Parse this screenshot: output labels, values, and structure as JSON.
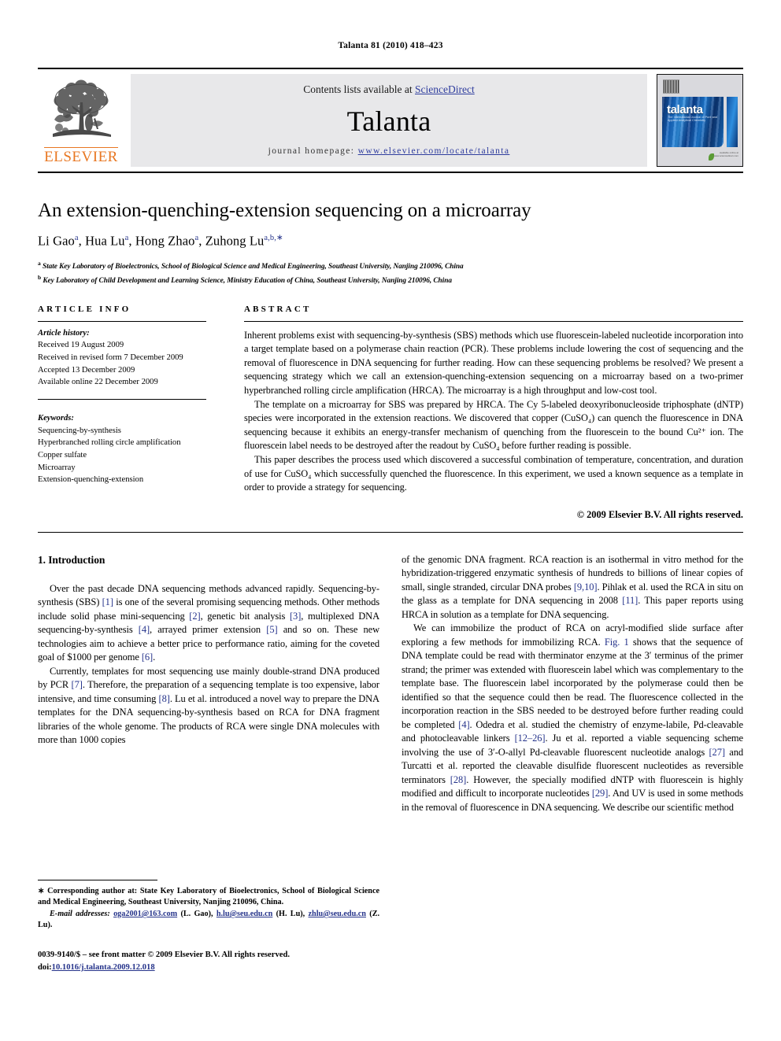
{
  "running_head": "Talanta 81 (2010) 418–423",
  "masthead": {
    "publisher_name": "ELSEVIER",
    "contents_prefix": "Contents lists available at ",
    "contents_link": "ScienceDirect",
    "journal_title": "Talanta",
    "homepage_label": "journal homepage:",
    "homepage_url": "www.elsevier.com/locate/talanta",
    "cover_title": "talanta",
    "cover_subtitle": "The International Journal of Pure and Applied Analytical Chemistry",
    "cover_footer": "available online at\nwww.sciencedirect.com",
    "link_color": "#2f3d9e",
    "brand_color": "#E87722"
  },
  "article": {
    "title": "An extension-quenching-extension sequencing on a microarray",
    "authors": [
      {
        "name": "Li Gao",
        "sup": "a"
      },
      {
        "name": "Hua Lu",
        "sup": "a"
      },
      {
        "name": "Hong Zhao",
        "sup": "a"
      },
      {
        "name": "Zuhong Lu",
        "sup": "a,b,∗"
      }
    ],
    "authors_line": "Li Gaoᵃ, Hua Luᵃ, Hong Zhaoᵃ, Zuhong Luᵃᵇ,*",
    "affiliations": [
      {
        "sup": "a",
        "text": "State Key Laboratory of Bioelectronics, School of Biological Science and Medical Engineering, Southeast University, Nanjing 210096, China"
      },
      {
        "sup": "b",
        "text": "Key Laboratory of Child Development and Learning Science, Ministry Education of China, Southeast University, Nanjing 210096, China"
      }
    ]
  },
  "article_info": {
    "heading": "ARTICLE INFO",
    "history_label": "Article history:",
    "history": [
      "Received 19 August 2009",
      "Received in revised form 7 December 2009",
      "Accepted 13 December 2009",
      "Available online 22 December 2009"
    ],
    "keywords_label": "Keywords:",
    "keywords": [
      "Sequencing-by-synthesis",
      "Hyperbranched rolling circle amplification",
      "Copper sulfate",
      "Microarray",
      "Extension-quenching-extension"
    ]
  },
  "abstract": {
    "heading": "ABSTRACT",
    "paragraphs": [
      "Inherent problems exist with sequencing-by-synthesis (SBS) methods which use fluorescein-labeled nucleotide incorporation into a target template based on a polymerase chain reaction (PCR). These problems include lowering the cost of sequencing and the removal of fluorescence in DNA sequencing for further reading. How can these sequencing problems be resolved? We present a sequencing strategy which we call an extension-quenching-extension sequencing on a microarray based on a two-primer hyperbranched rolling circle amplification (HRCA). The microarray is a high throughput and low-cost tool.",
      "The template on a microarray for SBS was prepared by HRCA. The Cy 5-labeled deoxyribonucleoside triphosphate (dNTP) species were incorporated in the extension reactions. We discovered that copper (CuSO₄) can quench the fluorescence in DNA sequencing because it exhibits an energy-transfer mechanism of quenching from the fluorescein to the bound Cu²⁺ ion. The fluorescein label needs to be destroyed after the readout by CuSO₄ before further reading is possible.",
      "This paper describes the process used which discovered a successful combination of temperature, concentration, and duration of use for CuSO₄ which successfully quenched the fluorescence. In this experiment, we used a known sequence as a template in order to provide a strategy for sequencing."
    ],
    "copyright": "© 2009 Elsevier B.V. All rights reserved."
  },
  "body": {
    "section_number_title": "1. Introduction",
    "left_paragraphs": [
      "Over the past decade DNA sequencing methods advanced rapidly. Sequencing-by-synthesis (SBS) [1] is one of the several promising sequencing methods. Other methods include solid phase mini-sequencing [2], genetic bit analysis [3], multiplexed DNA sequencing-by-synthesis [4], arrayed primer extension [5] and so on. These new technologies aim to achieve a better price to performance ratio, aiming for the coveted goal of $1000 per genome [6].",
      "Currently, templates for most sequencing use mainly double-strand DNA produced by PCR [7]. Therefore, the preparation of a sequencing template is too expensive, labor intensive, and time consuming [8]. Lu et al. introduced a novel way to prepare the DNA templates for the DNA sequencing-by-synthesis based on RCA for DNA fragment libraries of the whole genome. The products of RCA were single DNA molecules with more than 1000 copies"
    ],
    "right_paragraphs": [
      "of the genomic DNA fragment. RCA reaction is an isothermal in vitro method for the hybridization-triggered enzymatic synthesis of hundreds to billions of linear copies of small, single stranded, circular DNA probes [9,10]. Pihlak et al. used the RCA in situ on the glass as a template for DNA sequencing in 2008 [11]. This paper reports using HRCA in solution as a template for DNA sequencing.",
      "We can immobilize the product of RCA on acryl-modified slide surface after exploring a few methods for immobilizing RCA. Fig. 1 shows that the sequence of DNA template could be read with therminator enzyme at the 3′ terminus of the primer strand; the primer was extended with fluorescein label which was complementary to the template base. The fluorescein label incorporated by the polymerase could then be identified so that the sequence could then be read. The fluorescence collected in the incorporation reaction in the SBS needed to be destroyed before further reading could be completed [4]. Odedra et al. studied the chemistry of enzyme-labile, Pd-cleavable and photocleavable linkers [12–26]. Ju et al. reported a viable sequencing scheme involving the use of 3′-O-allyl Pd-cleavable fluorescent nucleotide analogs [27] and Turcatti et al. reported the cleavable disulfide fluorescent nucleotides as reversible terminators [28]. However, the specially modified dNTP with fluorescein is highly modified and difficult to incorporate nucleotides [29]. And UV is used in some methods in the removal of fluorescence in DNA sequencing. We describe our scientific method"
    ]
  },
  "footnotes": {
    "corresponding": "Corresponding author at: State Key Laboratory of Bioelectronics, School of Biological Science and Medical Engineering, Southeast University, Nanjing 210096, China.",
    "corresponding_marker": "∗",
    "email_label": "E-mail addresses:",
    "emails": [
      {
        "address": "oga2001@163.com",
        "person": "(L. Gao)"
      },
      {
        "address": "h.lu@seu.edu.cn",
        "person": "(H. Lu)"
      },
      {
        "address": "zhlu@seu.edu.cn",
        "person": "(Z. Lu)"
      }
    ],
    "issn_line": "0039-9140/$ – see front matter © 2009 Elsevier B.V. All rights reserved.",
    "doi_label": "doi:",
    "doi_value": "10.1016/j.talanta.2009.12.018"
  }
}
